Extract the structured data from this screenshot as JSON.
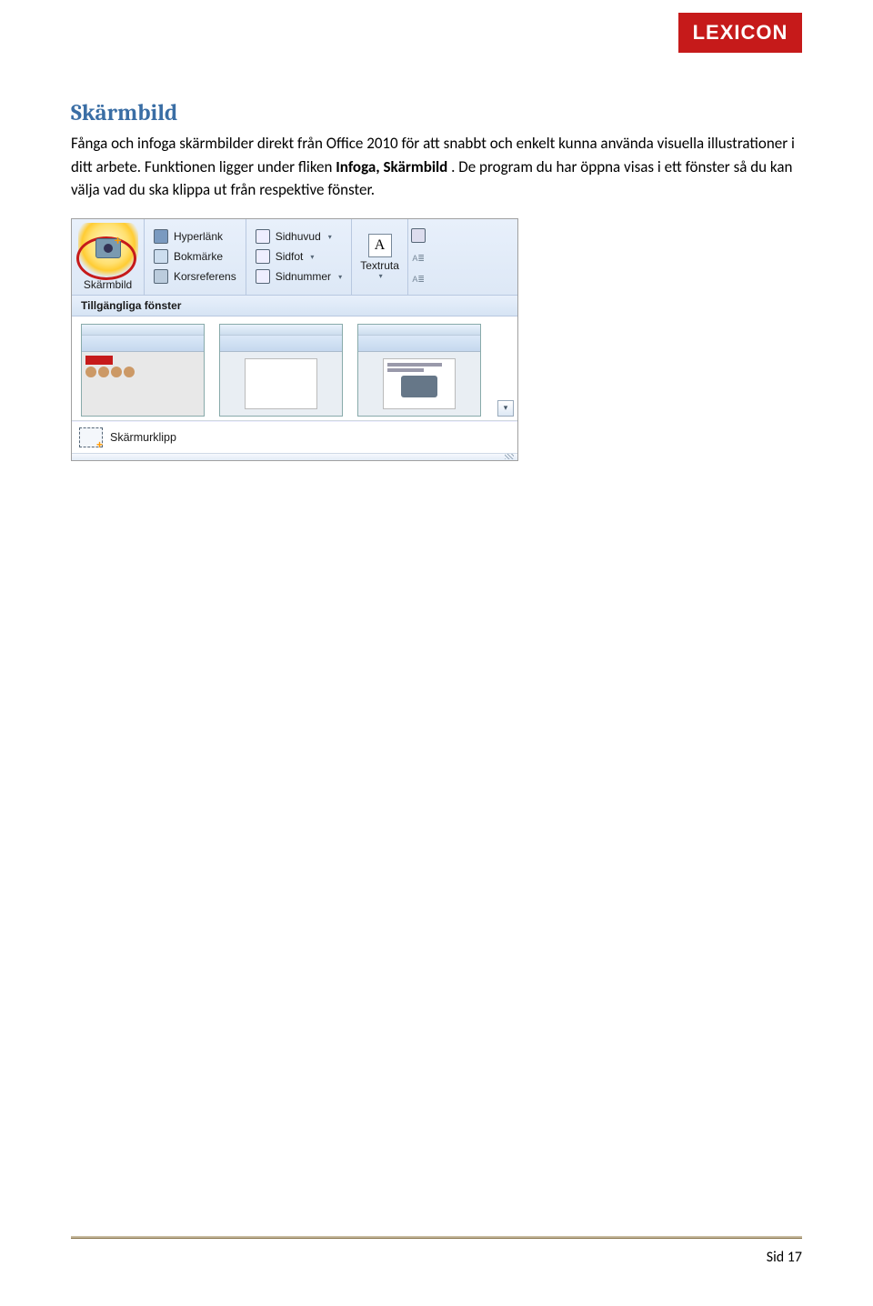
{
  "logo": "LEXICON",
  "heading": "Skärmbild",
  "paragraph": {
    "t1": "Fånga och infoga skärmbilder direkt från Office 2010 för att snabbt och enkelt kunna använda visuella illustrationer i ditt arbete. Funktionen ligger under fliken ",
    "b1": "Infoga, Skärmbild",
    "t2": ". De program du har öppna visas i ett fönster så du kan välja vad du ska klippa ut från respektive fönster."
  },
  "ribbon": {
    "skarmild": "Skärmbild",
    "hyperlink": "Hyperlänk",
    "bokmarke": "Bokmärke",
    "korsreferens": "Korsreferens",
    "sidhuvud": "Sidhuvud",
    "sidfot": "Sidfot",
    "sidnummer": "Sidnummer",
    "textruta": "Textruta"
  },
  "gallery": {
    "title": "Tillgängliga fönster",
    "clip": "Skärmurklipp"
  },
  "page_number": "Sid 17"
}
